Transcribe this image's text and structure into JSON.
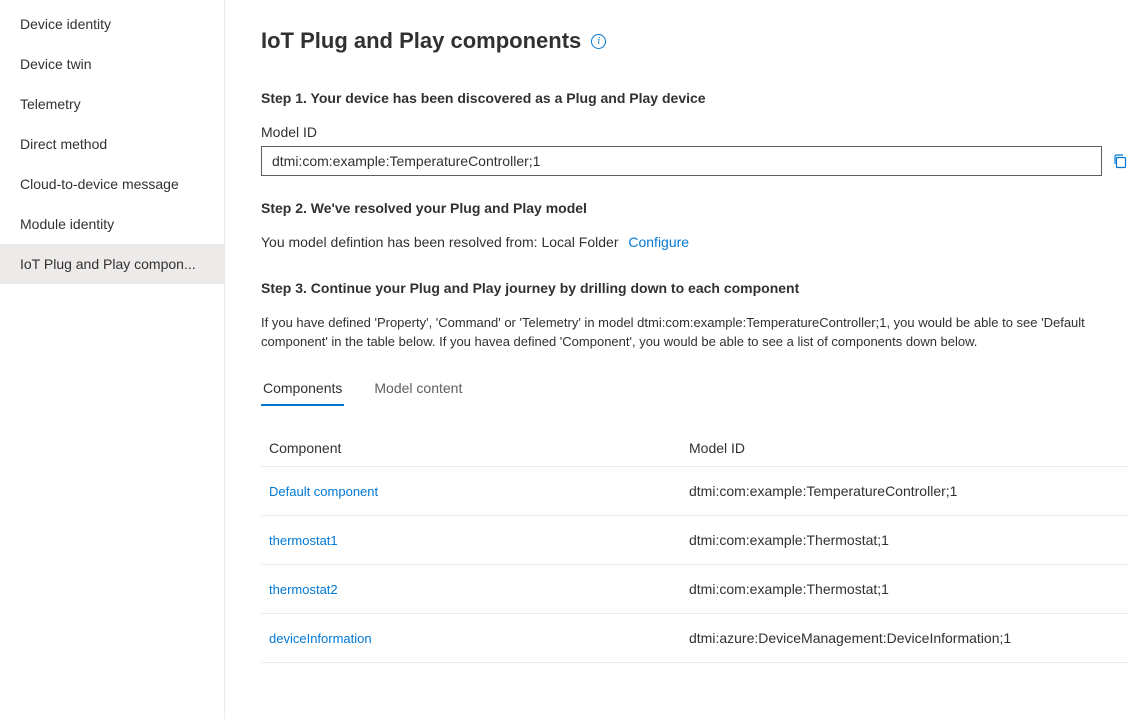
{
  "sidebar": {
    "items": [
      {
        "label": "Device identity"
      },
      {
        "label": "Device twin"
      },
      {
        "label": "Telemetry"
      },
      {
        "label": "Direct method"
      },
      {
        "label": "Cloud-to-device message"
      },
      {
        "label": "Module identity"
      },
      {
        "label": "IoT Plug and Play compon..."
      }
    ]
  },
  "page": {
    "title": "IoT Plug and Play components"
  },
  "step1": {
    "heading": "Step 1. Your device has been discovered as a Plug and Play device",
    "field_label": "Model ID",
    "model_id": "dtmi:com:example:TemperatureController;1"
  },
  "step2": {
    "heading": "Step 2. We've resolved your Plug and Play model",
    "resolved_text": "You model defintion has been resolved from: Local Folder",
    "configure_link": "Configure"
  },
  "step3": {
    "heading": "Step 3. Continue your Plug and Play journey by drilling down to each component",
    "description": "If you have defined 'Property', 'Command' or 'Telemetry' in model dtmi:com:example:TemperatureController;1, you would be able to see 'Default component' in the table below. If you havea defined 'Component', you would be able to see a list of components down below."
  },
  "tabs": {
    "components": "Components",
    "model_content": "Model content"
  },
  "table": {
    "header_component": "Component",
    "header_model_id": "Model ID",
    "rows": [
      {
        "component": "Default component",
        "model_id": "dtmi:com:example:TemperatureController;1"
      },
      {
        "component": "thermostat1",
        "model_id": "dtmi:com:example:Thermostat;1"
      },
      {
        "component": "thermostat2",
        "model_id": "dtmi:com:example:Thermostat;1"
      },
      {
        "component": "deviceInformation",
        "model_id": "dtmi:azure:DeviceManagement:DeviceInformation;1"
      }
    ]
  }
}
